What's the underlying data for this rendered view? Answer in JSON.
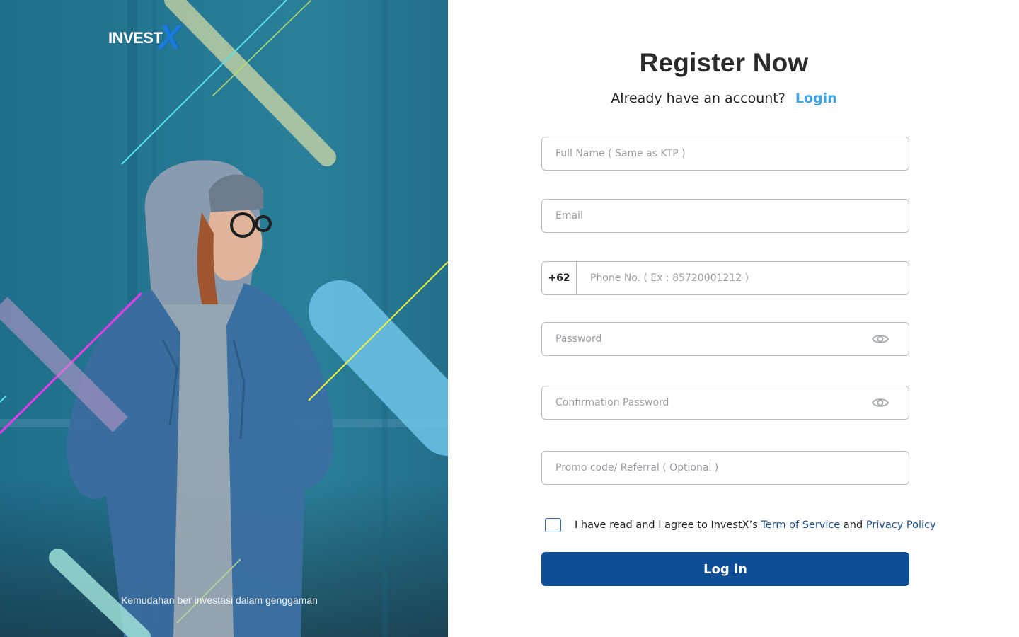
{
  "brand": {
    "logo_text": "INVEST",
    "logo_mark": "X",
    "tagline": "Kemudahan ber investasi dalam genggaman"
  },
  "register": {
    "title": "Register Now",
    "have_account_text": "Already have an account?",
    "login_link": "Login"
  },
  "form": {
    "full_name_placeholder": "Full Name ( Same as KTP )",
    "email_placeholder": "Email",
    "phone_prefix": "+62",
    "phone_placeholder": "Phone No. ( Ex : 85720001212 )",
    "password_placeholder": "Password",
    "confirm_password_placeholder": "Confirmation Password",
    "promo_placeholder": "Promo code/ Referral ( Optional )",
    "agree_prefix": "I have read and I agree to InvestX’s",
    "terms_link": "Term of Service",
    "agree_and": "and",
    "privacy_link": "Privacy Policy",
    "submit_label": "Log in"
  },
  "icons": {
    "password_visibility": "eye-icon",
    "confirm_visibility": "eye-icon"
  },
  "colors": {
    "primary": "#0d4e96",
    "link": "#3da3e6",
    "border": "#b8bcc2",
    "hero_bg": "#257894"
  }
}
